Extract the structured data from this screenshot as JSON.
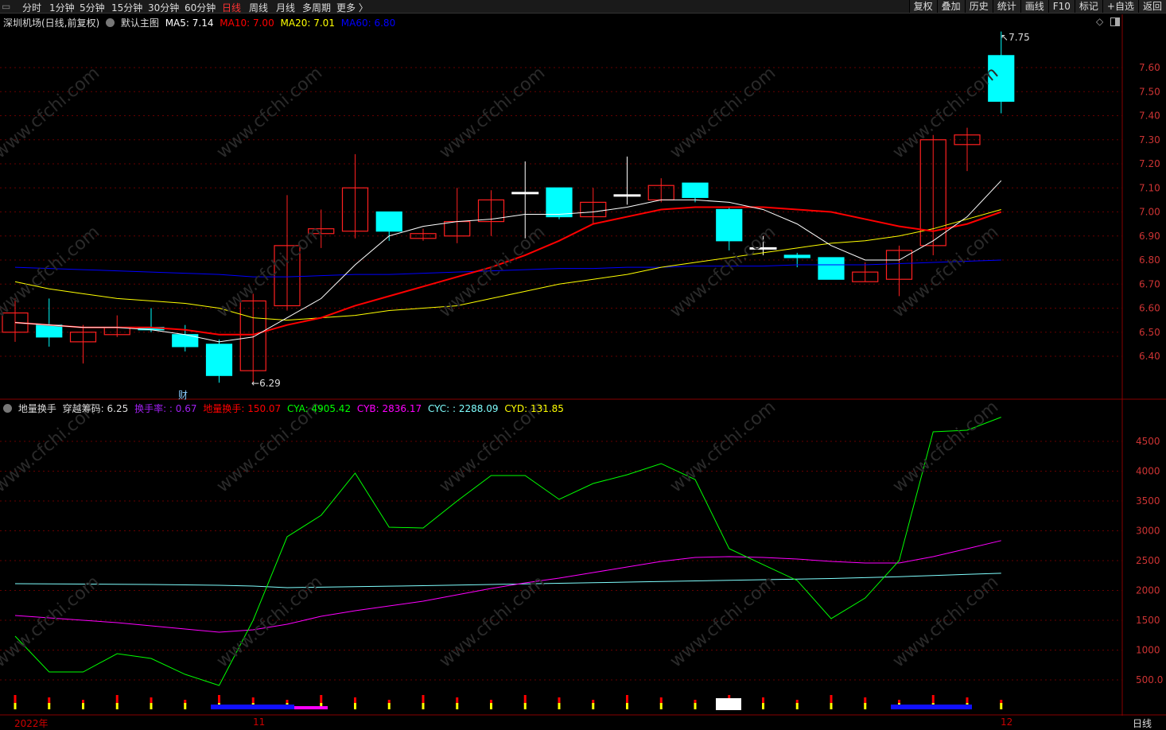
{
  "topbar": {
    "tabs": [
      "分时",
      "1分钟",
      "5分钟",
      "15分钟",
      "30分钟",
      "60分钟",
      "日线",
      "周线",
      "月线",
      "多周期",
      "更多 〉"
    ],
    "active": "日线",
    "buttons": [
      "复权",
      "叠加",
      "历史",
      "统计",
      "画线",
      "F10",
      "标记",
      "+自选",
      "返回"
    ]
  },
  "main_legend": {
    "title": "深圳机场(日线,前复权)",
    "indicator": "默认主图",
    "ma5": "MA5: 7.14",
    "ma10": "MA10: 7.00",
    "ma20": "MA20: 7.01",
    "ma60": "MA60: 6.80"
  },
  "sub_legend": {
    "title": "地量换手",
    "cross": "穿越筹码: 6.25",
    "turnover": "换手率: : 0.67",
    "low_turnover": "地量换手: 150.07",
    "cya": "CYA: 4905.42",
    "cyb": "CYB: 2836.17",
    "cyc": "CYC: : 2288.09",
    "cyd": "CYD: 131.85"
  },
  "annotations": {
    "high": "7.75",
    "low": "6.29",
    "cai": "财"
  },
  "xaxis": {
    "start": "2022年",
    "m11": "11",
    "m12": "12",
    "period": "日线"
  },
  "colors": {
    "up": "#ff2020",
    "down": "#00ffff",
    "ma5": "#ffffff",
    "ma10": "#ff0000",
    "ma20": "#ffff00",
    "ma60": "#0000ff",
    "cya": "#00ff00",
    "cyb": "#ff00ff",
    "cyc": "#80ffff"
  },
  "chart_data": [
    {
      "type": "candlestick",
      "yticks": [
        "7.60",
        "7.50",
        "7.40",
        "7.30",
        "7.20",
        "7.10",
        "7.00",
        "6.90",
        "6.80",
        "6.70",
        "6.60",
        "6.50",
        "6.40"
      ],
      "ohlc": [
        [
          6.5,
          6.64,
          6.46,
          6.58
        ],
        [
          6.53,
          6.64,
          6.44,
          6.48
        ],
        [
          6.46,
          6.53,
          6.37,
          6.5
        ],
        [
          6.49,
          6.57,
          6.48,
          6.52
        ],
        [
          6.52,
          6.6,
          6.5,
          6.51
        ],
        [
          6.49,
          6.53,
          6.42,
          6.44
        ],
        [
          6.45,
          6.47,
          6.29,
          6.32
        ],
        [
          6.34,
          6.66,
          6.29,
          6.63
        ],
        [
          6.61,
          7.07,
          6.59,
          6.86
        ],
        [
          6.91,
          7.01,
          6.85,
          6.93
        ],
        [
          6.92,
          7.24,
          6.89,
          7.1
        ],
        [
          7.0,
          7.0,
          6.88,
          6.92
        ],
        [
          6.89,
          6.93,
          6.88,
          6.91
        ],
        [
          6.9,
          7.1,
          6.87,
          6.96
        ],
        [
          6.96,
          7.09,
          6.9,
          7.05
        ],
        [
          7.08,
          7.21,
          6.89,
          7.08
        ],
        [
          7.1,
          7.1,
          6.97,
          6.98
        ],
        [
          6.98,
          7.1,
          6.95,
          7.04
        ],
        [
          7.07,
          7.23,
          7.03,
          7.07
        ],
        [
          7.05,
          7.14,
          7.04,
          7.11
        ],
        [
          7.12,
          7.12,
          7.04,
          7.06
        ],
        [
          7.01,
          7.02,
          6.84,
          6.88
        ],
        [
          6.85,
          6.9,
          6.82,
          6.85
        ],
        [
          6.82,
          6.83,
          6.77,
          6.81
        ],
        [
          6.81,
          6.81,
          6.72,
          6.72
        ],
        [
          6.71,
          6.79,
          6.71,
          6.75
        ],
        [
          6.72,
          6.86,
          6.65,
          6.84
        ],
        [
          6.86,
          7.32,
          6.82,
          7.3
        ],
        [
          7.28,
          7.35,
          7.17,
          7.32
        ],
        [
          7.65,
          7.75,
          7.41,
          7.46
        ]
      ],
      "ma5": [
        6.54,
        6.53,
        6.52,
        6.52,
        6.51,
        6.49,
        6.46,
        6.48,
        6.56,
        6.64,
        6.78,
        6.9,
        6.94,
        6.96,
        6.97,
        6.99,
        6.99,
        7.0,
        7.02,
        7.05,
        7.05,
        7.04,
        7.01,
        6.95,
        6.86,
        6.8,
        6.8,
        6.88,
        6.98,
        7.13
      ],
      "ma10": [
        6.54,
        6.53,
        6.52,
        6.52,
        6.52,
        6.51,
        6.49,
        6.49,
        6.53,
        6.56,
        6.61,
        6.65,
        6.69,
        6.73,
        6.77,
        6.82,
        6.88,
        6.95,
        6.98,
        7.01,
        7.02,
        7.02,
        7.02,
        7.01,
        7.0,
        6.97,
        6.94,
        6.92,
        6.95,
        7.0
      ],
      "ma20": [
        6.71,
        6.68,
        6.66,
        6.64,
        6.63,
        6.62,
        6.6,
        6.56,
        6.55,
        6.56,
        6.57,
        6.59,
        6.6,
        6.61,
        6.64,
        6.67,
        6.7,
        6.72,
        6.74,
        6.77,
        6.79,
        6.81,
        6.83,
        6.85,
        6.87,
        6.88,
        6.9,
        6.93,
        6.97,
        7.01
      ],
      "ma60": [
        6.77,
        6.765,
        6.76,
        6.755,
        6.75,
        6.745,
        6.74,
        6.73,
        6.73,
        6.735,
        6.74,
        6.74,
        6.745,
        6.75,
        6.755,
        6.76,
        6.765,
        6.765,
        6.77,
        6.77,
        6.775,
        6.775,
        6.775,
        6.78,
        6.78,
        6.78,
        6.785,
        6.79,
        6.795,
        6.8
      ]
    },
    {
      "type": "line",
      "yticks": [
        "4500",
        "4000",
        "3500",
        "3000",
        "2500",
        "2000",
        "1500",
        "1000",
        "500.0"
      ],
      "cya": [
        1233,
        633,
        633,
        940,
        860,
        593,
        407,
        1500,
        2900,
        3260,
        3967,
        3060,
        3047,
        3500,
        3927,
        3927,
        3527,
        3793,
        3940,
        4127,
        3860,
        2700,
        2433,
        2167,
        1527,
        1873,
        2500,
        4660,
        4687,
        4905
      ],
      "cyb": [
        1580,
        1540,
        1500,
        1460,
        1407,
        1353,
        1300,
        1340,
        1433,
        1567,
        1660,
        1740,
        1820,
        1927,
        2033,
        2127,
        2207,
        2300,
        2393,
        2487,
        2553,
        2567,
        2553,
        2527,
        2487,
        2460,
        2460,
        2567,
        2700,
        2836
      ],
      "cyc": [
        2113,
        2110,
        2107,
        2103,
        2100,
        2093,
        2087,
        2073,
        2047,
        2055,
        2063,
        2072,
        2080,
        2090,
        2100,
        2110,
        2120,
        2130,
        2140,
        2150,
        2160,
        2170,
        2180,
        2190,
        2200,
        2215,
        2230,
        2250,
        2270,
        2288
      ]
    }
  ]
}
